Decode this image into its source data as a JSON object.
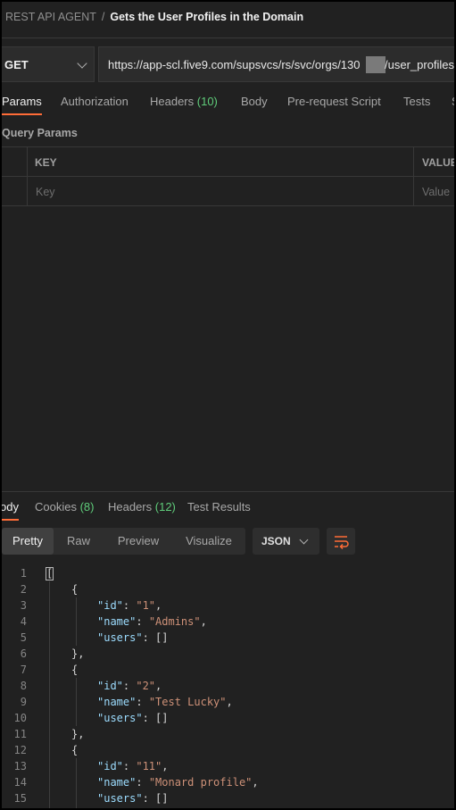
{
  "breadcrumb": {
    "parent": "REST API AGENT",
    "separator": "/",
    "current": "Gets the User Profiles in the Domain"
  },
  "request": {
    "method": "GET",
    "url_before_mask": "https://app-scl.five9.com/supsvcs/rs/svc/orgs/130",
    "url_after_mask": "/user_profiles"
  },
  "request_tabs": [
    {
      "label": "Params",
      "count": ""
    },
    {
      "label": "Authorization",
      "count": ""
    },
    {
      "label": "Headers",
      "count": "(10)"
    },
    {
      "label": "Body",
      "count": ""
    },
    {
      "label": "Pre-request Script",
      "count": ""
    },
    {
      "label": "Tests",
      "count": ""
    },
    {
      "label": "S",
      "count": ""
    }
  ],
  "query_params": {
    "title": "Query Params",
    "key_header": "KEY",
    "value_header": "VALUE",
    "key_placeholder": "Key",
    "value_placeholder": "Value"
  },
  "response_tabs": [
    {
      "label": "ody",
      "count": ""
    },
    {
      "label": "Cookies",
      "count": "(8)"
    },
    {
      "label": "Headers",
      "count": "(12)"
    },
    {
      "label": "Test Results",
      "count": ""
    }
  ],
  "view_modes": [
    "Pretty",
    "Raw",
    "Preview",
    "Visualize"
  ],
  "active_view": "Pretty",
  "format": "JSON",
  "code": {
    "line_numbers": [
      "1",
      "2",
      "3",
      "4",
      "5",
      "6",
      "7",
      "8",
      "9",
      "10",
      "11",
      "12",
      "13",
      "14",
      "15"
    ],
    "profiles": [
      {
        "id_key": "\"id\"",
        "id_value": "\"1\"",
        "name_key": "\"name\"",
        "name_value": "\"Admins\"",
        "users_key": "\"users\"",
        "users_value": "[]"
      },
      {
        "id_key": "\"id\"",
        "id_value": "\"2\"",
        "name_key": "\"name\"",
        "name_value": "\"Test Lucky\"",
        "users_key": "\"users\"",
        "users_value": "[]"
      },
      {
        "id_key": "\"id\"",
        "id_value": "\"11\"",
        "name_key": "\"name\"",
        "name_value": "\"Monard profile\"",
        "users_key": "\"users\"",
        "users_value": "[]"
      }
    ],
    "open_bracket": "[",
    "open_brace": "{",
    "close_brace": "},"
  },
  "colors": {
    "accent": "#ff6c37",
    "count_green": "#5fcc7a",
    "json_key": "#9cdcfe",
    "json_string": "#ce9178",
    "background": "#212121"
  }
}
